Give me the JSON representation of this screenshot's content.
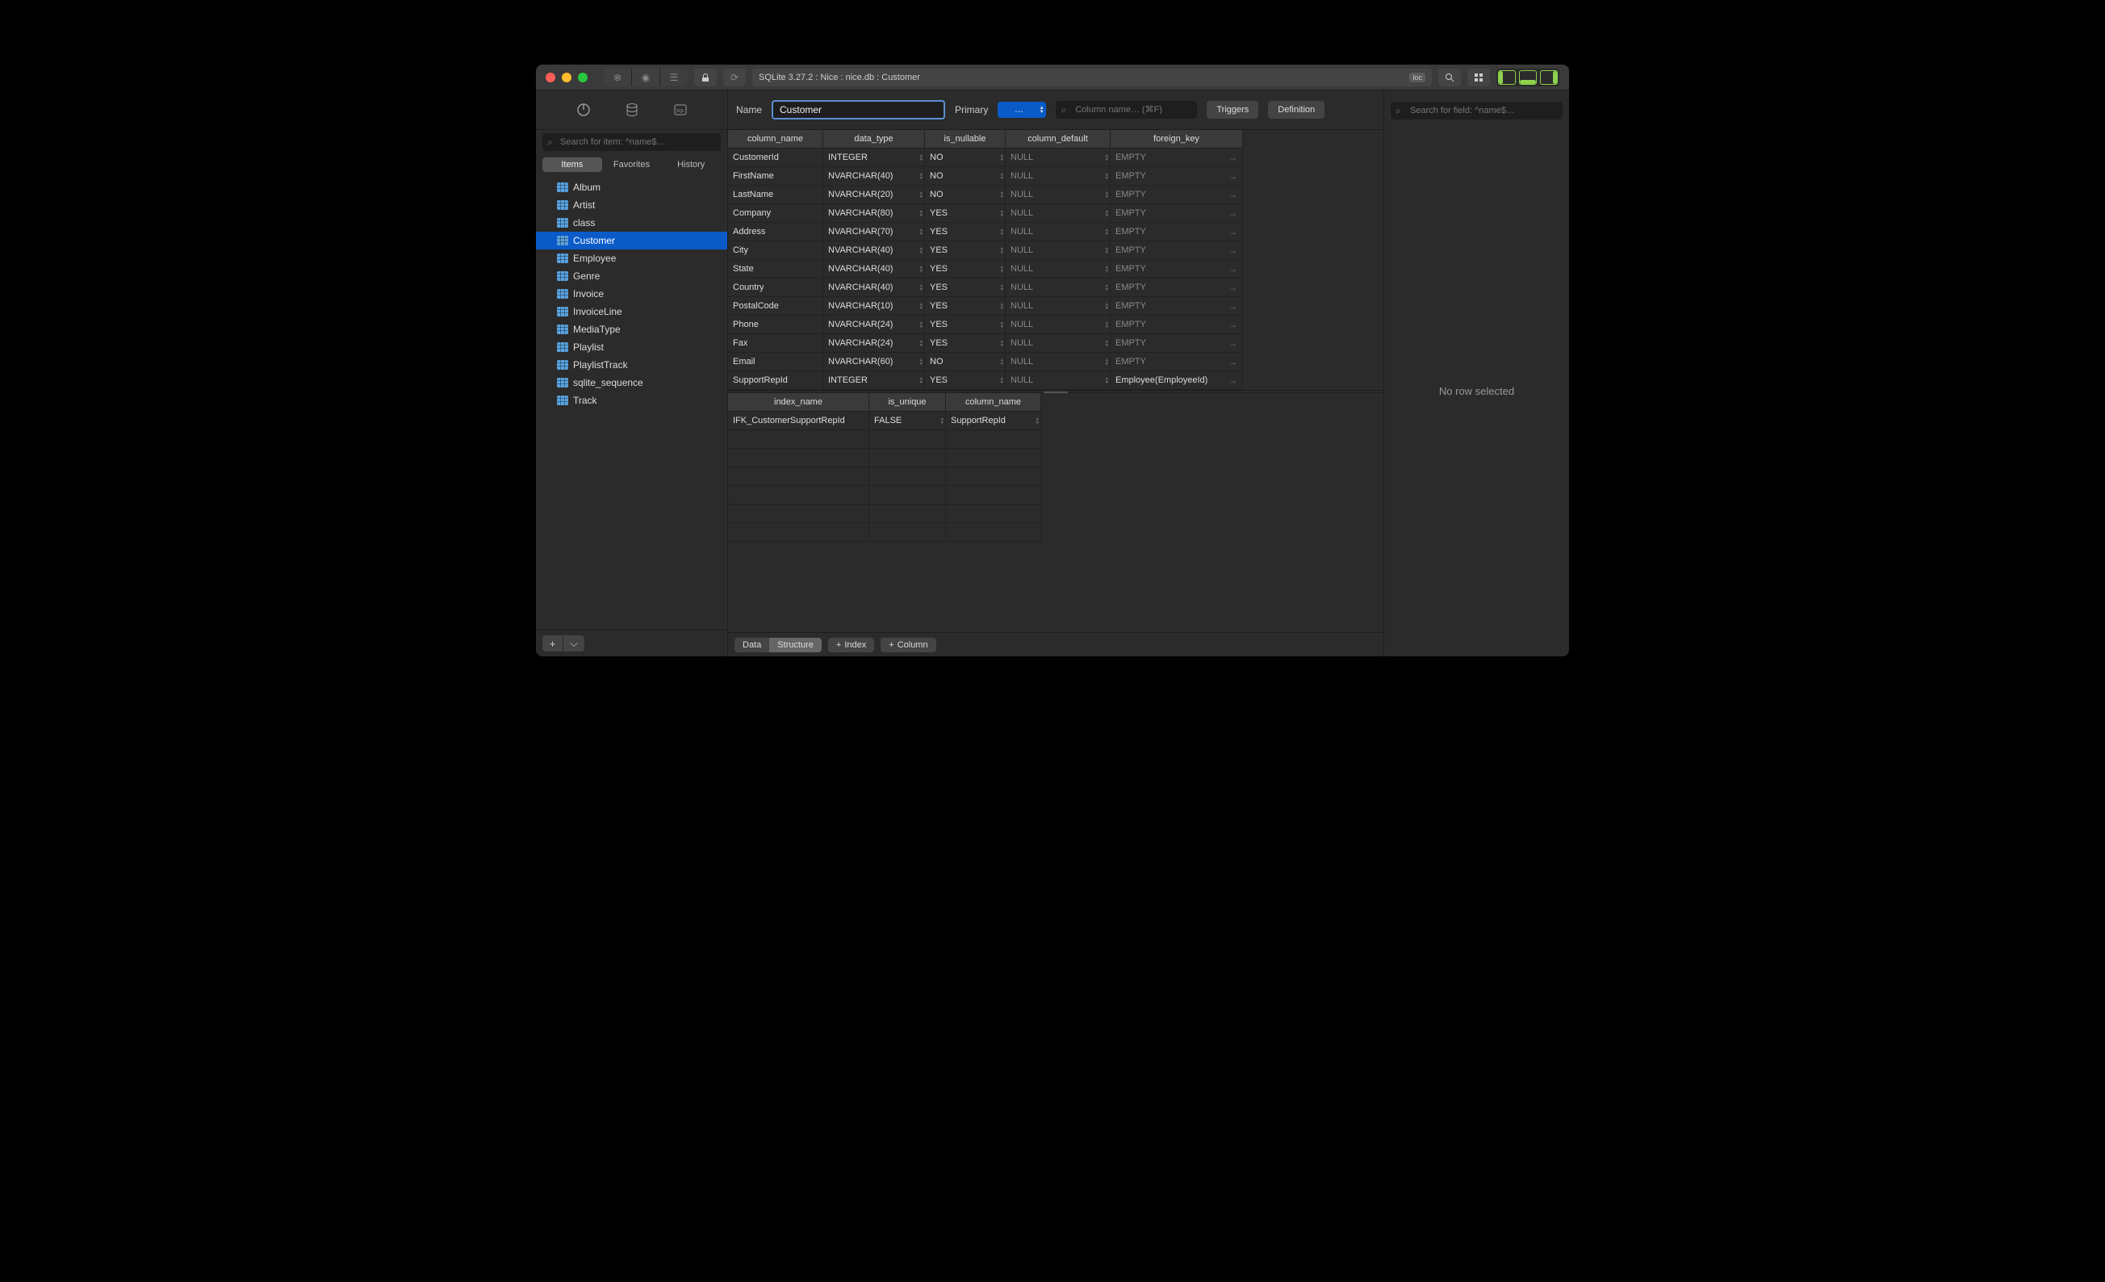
{
  "titlebar": {
    "address": "SQLite 3.27.2 : Nice : nice.db : Customer",
    "loc": "loc"
  },
  "sidebar": {
    "search_placeholder": "Search for item: ^name$…",
    "tabs": {
      "items": "Items",
      "favorites": "Favorites",
      "history": "History"
    },
    "tables": [
      {
        "name": "Album"
      },
      {
        "name": "Artist"
      },
      {
        "name": "class"
      },
      {
        "name": "Customer",
        "selected": true
      },
      {
        "name": "Employee"
      },
      {
        "name": "Genre"
      },
      {
        "name": "Invoice"
      },
      {
        "name": "InvoiceLine"
      },
      {
        "name": "MediaType"
      },
      {
        "name": "Playlist"
      },
      {
        "name": "PlaylistTrack"
      },
      {
        "name": "sqlite_sequence"
      },
      {
        "name": "Track"
      }
    ]
  },
  "header": {
    "name_label": "Name",
    "name_value": "Customer",
    "primary_label": "Primary",
    "primary_value": "…",
    "colsearch_placeholder": "Column name… (⌘F)",
    "triggers": "Triggers",
    "definition": "Definition"
  },
  "columns": {
    "headers": {
      "name": "column_name",
      "type": "data_type",
      "null": "is_nullable",
      "def": "column_default",
      "fk": "foreign_key"
    },
    "rows": [
      {
        "name": "CustomerId",
        "type": "INTEGER",
        "null": "NO",
        "def": "NULL",
        "fk": "EMPTY"
      },
      {
        "name": "FirstName",
        "type": "NVARCHAR(40)",
        "null": "NO",
        "def": "NULL",
        "fk": "EMPTY"
      },
      {
        "name": "LastName",
        "type": "NVARCHAR(20)",
        "null": "NO",
        "def": "NULL",
        "fk": "EMPTY"
      },
      {
        "name": "Company",
        "type": "NVARCHAR(80)",
        "null": "YES",
        "def": "NULL",
        "fk": "EMPTY"
      },
      {
        "name": "Address",
        "type": "NVARCHAR(70)",
        "null": "YES",
        "def": "NULL",
        "fk": "EMPTY"
      },
      {
        "name": "City",
        "type": "NVARCHAR(40)",
        "null": "YES",
        "def": "NULL",
        "fk": "EMPTY"
      },
      {
        "name": "State",
        "type": "NVARCHAR(40)",
        "null": "YES",
        "def": "NULL",
        "fk": "EMPTY"
      },
      {
        "name": "Country",
        "type": "NVARCHAR(40)",
        "null": "YES",
        "def": "NULL",
        "fk": "EMPTY"
      },
      {
        "name": "PostalCode",
        "type": "NVARCHAR(10)",
        "null": "YES",
        "def": "NULL",
        "fk": "EMPTY"
      },
      {
        "name": "Phone",
        "type": "NVARCHAR(24)",
        "null": "YES",
        "def": "NULL",
        "fk": "EMPTY"
      },
      {
        "name": "Fax",
        "type": "NVARCHAR(24)",
        "null": "YES",
        "def": "NULL",
        "fk": "EMPTY"
      },
      {
        "name": "Email",
        "type": "NVARCHAR(60)",
        "null": "NO",
        "def": "NULL",
        "fk": "EMPTY"
      },
      {
        "name": "SupportRepId",
        "type": "INTEGER",
        "null": "YES",
        "def": "NULL",
        "fk": "Employee(EmployeeId)"
      }
    ]
  },
  "indexes": {
    "headers": {
      "name": "index_name",
      "uniq": "is_unique",
      "col": "column_name"
    },
    "rows": [
      {
        "name": "IFK_CustomerSupportRepId",
        "uniq": "FALSE",
        "col": "SupportRepId"
      }
    ]
  },
  "footer": {
    "data": "Data",
    "structure": "Structure",
    "index": "Index",
    "column": "Column"
  },
  "right": {
    "search_placeholder": "Search for field: ^name$…",
    "empty": "No row selected"
  }
}
